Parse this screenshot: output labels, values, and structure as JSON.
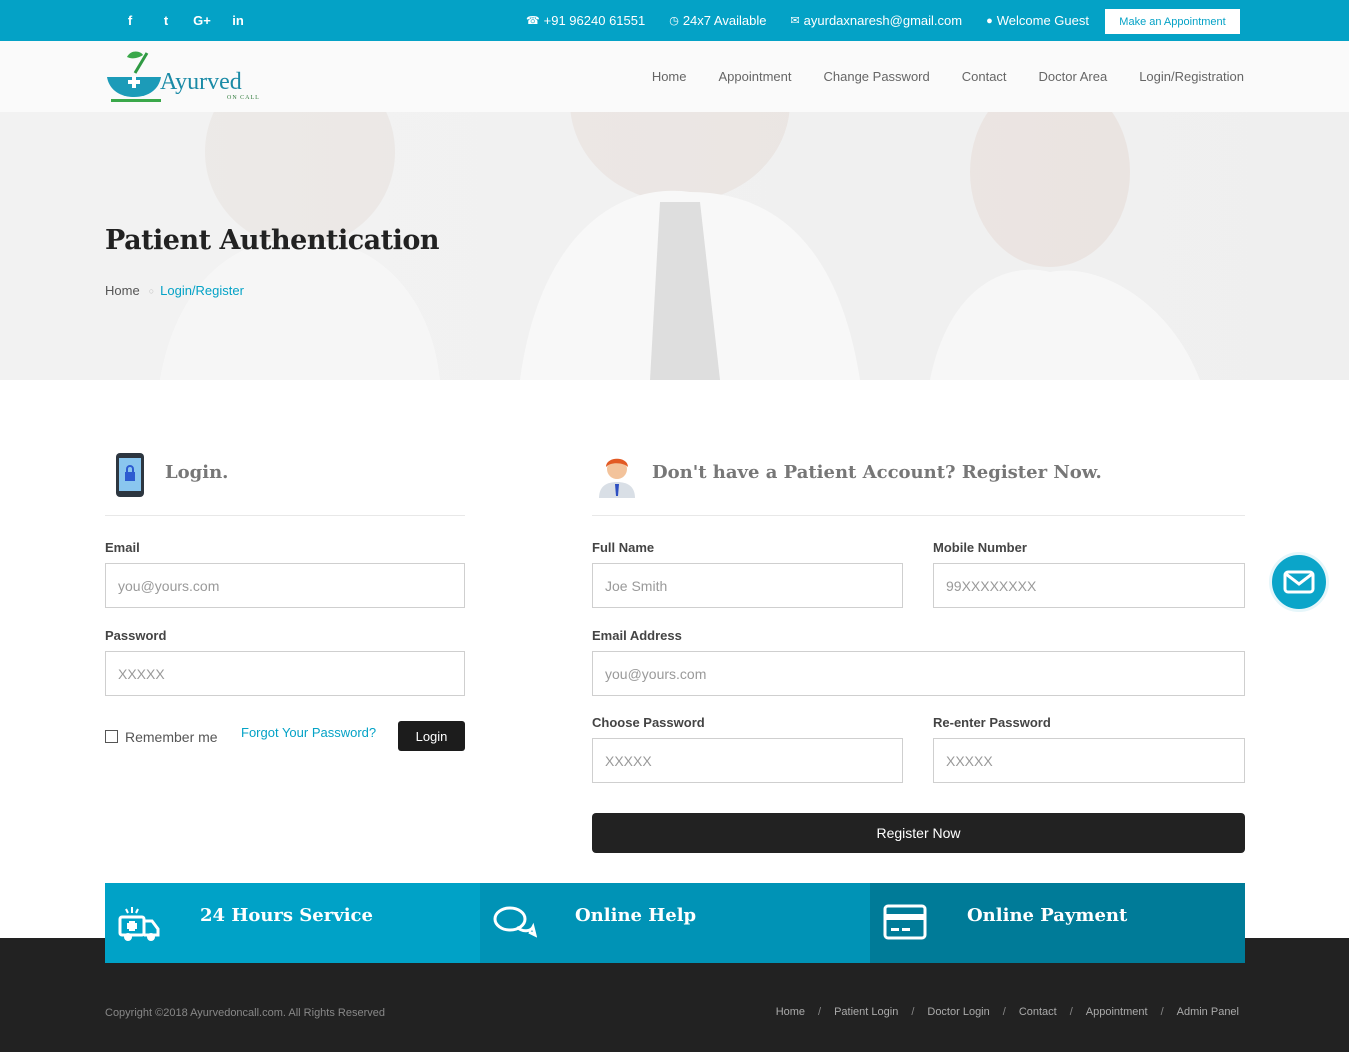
{
  "topbar": {
    "social": [
      {
        "icon": "facebook-icon",
        "glyph": "f"
      },
      {
        "icon": "twitter-icon",
        "glyph": "t"
      },
      {
        "icon": "google-plus-icon",
        "glyph": "G+"
      },
      {
        "icon": "linkedin-icon",
        "glyph": "in"
      }
    ],
    "phone": "+91 96240 61551",
    "availability": "24x7 Available",
    "email": "ayurdaxnaresh@gmail.com",
    "welcome": "Welcome Guest",
    "appointment_button": "Make an Appointment"
  },
  "brand": {
    "name": "Ayurved",
    "tagline": "ON CALL"
  },
  "nav": [
    "Home",
    "Appointment",
    "Change Password",
    "Contact",
    "Doctor Area",
    "Login/Registration"
  ],
  "hero": {
    "title": "Patient Authentication",
    "breadcrumb_home": "Home",
    "breadcrumb_current": "Login/Register"
  },
  "login": {
    "title": "Login.",
    "email_label": "Email",
    "email_placeholder": "you@yours.com",
    "password_label": "Password",
    "password_placeholder": "XXXXX",
    "remember": "Remember me",
    "forgot": "Forgot Your Password?",
    "button": "Login"
  },
  "register": {
    "title": "Don't have a Patient Account? Register Now.",
    "fullname_label": "Full Name",
    "fullname_placeholder": "Joe Smith",
    "mobile_label": "Mobile Number",
    "mobile_placeholder": "99XXXXXXXX",
    "email_label": "Email Address",
    "email_placeholder": "you@yours.com",
    "password_label": "Choose Password",
    "password_placeholder": "XXXXX",
    "repassword_label": "Re-enter Password",
    "repassword_placeholder": "XXXXX",
    "button": "Register Now"
  },
  "features": [
    {
      "title": "24 Hours Service",
      "icon": "ambulance-icon",
      "color": "#00a2c7"
    },
    {
      "title": "Online Help",
      "icon": "chat-bubbles-icon",
      "color": "#0093b6"
    },
    {
      "title": "Online Payment",
      "icon": "credit-card-icon",
      "color": "#007b98"
    }
  ],
  "footer": {
    "copyright": "Copyright ©2018 Ayurvedoncall.com. All Rights Reserved",
    "links": [
      "Home",
      "Patient Login",
      "Doctor Login",
      "Contact",
      "Appointment",
      "Admin Panel"
    ]
  }
}
